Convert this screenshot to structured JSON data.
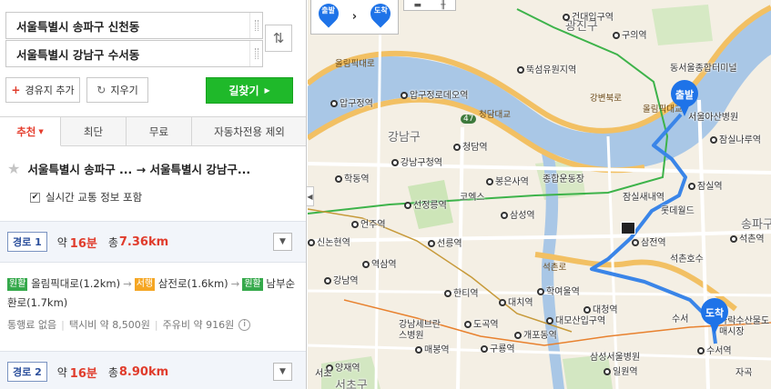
{
  "search": {
    "origin": "서울특별시 송파구 신천동",
    "destination": "서울특별시 강남구 수서동",
    "add_waypoint_label": "경유지 추가",
    "clear_label": "지우기",
    "search_label": "길찾기"
  },
  "tabs": [
    {
      "label": "추천",
      "active": true
    },
    {
      "label": "최단"
    },
    {
      "label": "무료"
    },
    {
      "label": "자동차전용 제외"
    }
  ],
  "result": {
    "title": "서울특별시 송파구 ... → 서울특별시 강남구...",
    "realtime_label": "실시간 교통 정보 포함"
  },
  "routes": [
    {
      "badge": "경로 1",
      "time_prefix": "약",
      "time": "16분",
      "dist_prefix": "총",
      "dist": "7.36km",
      "segments": [
        {
          "tag": "원활",
          "road": "올림픽대로(1.2km)"
        },
        {
          "tag": "서행",
          "road": "삼전로(1.6km)"
        },
        {
          "tag": "원활",
          "road": "남부순환로(1.7km)"
        }
      ],
      "toll": "통행료 없음",
      "taxi": "택시비 약 8,500원",
      "fuel": "주유비 약 916원"
    },
    {
      "badge": "경로 2",
      "time_prefix": "약",
      "time": "16분",
      "dist_prefix": "총",
      "dist": "8.90km"
    }
  ],
  "map": {
    "legend_start": "출발",
    "legend_end": "도착",
    "pin_start": "출발",
    "pin_end": "도착",
    "labels": [
      "건대입구역",
      "광진구",
      "구의역",
      "뚝섬유원지역",
      "올림픽대로",
      "동서울종합터미널",
      "압구정역",
      "압구정로데오역",
      "청담대교",
      "강변북로",
      "올림픽대교",
      "47",
      "강남구",
      "청담역",
      "서울아산병원",
      "잠실나루역",
      "학동역",
      "강남구청역",
      "봉은사역",
      "종합운동장",
      "잠실역",
      "잠실새내역",
      "롯데월드",
      "선정릉역",
      "코엑스",
      "삼성역",
      "석촌역",
      "언주역",
      "삼전역",
      "석촌호수",
      "신논현역",
      "선릉역",
      "송파구",
      "역삼역",
      "석촌로",
      "강남역",
      "한티역",
      "학여울역",
      "대청역",
      "대치역",
      "대모산입구역",
      "도곡역",
      "개포동역",
      "구룡역",
      "매봉역",
      "강남세브란스병원",
      "삼성서울병원",
      "일원역",
      "수서",
      "가락수산물도매시장",
      "수서역",
      "양재역",
      "서초구",
      "서초",
      "자곡"
    ]
  },
  "colors": {
    "accent_green": "#1fb92a",
    "route_blue": "#3a85e8",
    "red_text": "#e03c2c",
    "pin_blue": "#1e73e8"
  }
}
